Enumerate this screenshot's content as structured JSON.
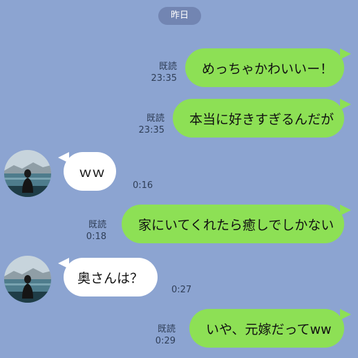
{
  "date_label": "昨日",
  "messages": [
    {
      "text": "めっちゃかわいいー！",
      "read": "既読",
      "time": "23:35"
    },
    {
      "text": "本当に好きすぎるんだが",
      "read": "既読",
      "time": "23:35"
    },
    {
      "text": "ｗｗ",
      "time": "0:16"
    },
    {
      "text": "家にいてくれたら癒しでしかない",
      "read": "既読",
      "time": "0:18"
    },
    {
      "text": "奥さんは？",
      "time": "0:27"
    },
    {
      "text": "いや、元嫁だってww",
      "read": "既読",
      "time": "0:29"
    }
  ],
  "colors": {
    "background": "#8ca4d1",
    "outgoing_bubble": "#8de055",
    "incoming_bubble": "#ffffff",
    "date_pill": "#7285b2"
  },
  "icons": [
    "avatar-photo"
  ]
}
